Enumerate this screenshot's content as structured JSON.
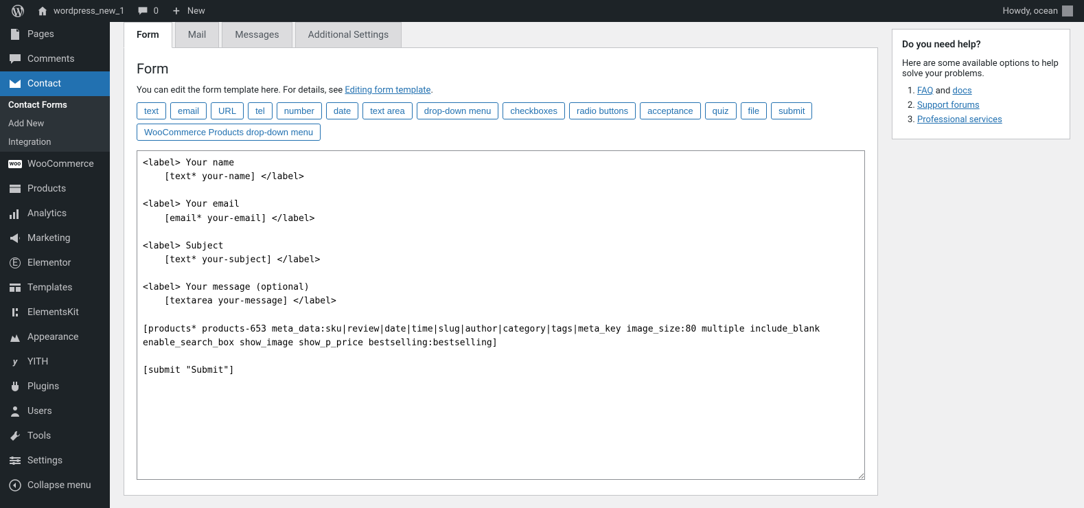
{
  "topbar": {
    "site_name": "wordpress_new_1",
    "comment_count": "0",
    "new_label": "New",
    "greeting": "Howdy, ocean"
  },
  "sidebar": {
    "items": [
      {
        "icon": "pages",
        "label": "Pages"
      },
      {
        "icon": "comments",
        "label": "Comments"
      },
      {
        "icon": "contact",
        "label": "Contact",
        "active": true
      },
      {
        "icon": "woo",
        "label": "WooCommerce"
      },
      {
        "icon": "products",
        "label": "Products"
      },
      {
        "icon": "analytics",
        "label": "Analytics"
      },
      {
        "icon": "marketing",
        "label": "Marketing"
      },
      {
        "icon": "elementor",
        "label": "Elementor"
      },
      {
        "icon": "templates",
        "label": "Templates"
      },
      {
        "icon": "elementskit",
        "label": "ElementsKit"
      },
      {
        "icon": "appearance",
        "label": "Appearance"
      },
      {
        "icon": "yith",
        "label": "YITH"
      },
      {
        "icon": "plugins",
        "label": "Plugins"
      },
      {
        "icon": "users",
        "label": "Users"
      },
      {
        "icon": "tools",
        "label": "Tools"
      },
      {
        "icon": "settings",
        "label": "Settings"
      },
      {
        "icon": "collapse",
        "label": "Collapse menu"
      }
    ],
    "contact_sub": [
      {
        "label": "Contact Forms",
        "active": true
      },
      {
        "label": "Add New"
      },
      {
        "label": "Integration"
      }
    ]
  },
  "tabs": [
    {
      "label": "Form",
      "active": true
    },
    {
      "label": "Mail"
    },
    {
      "label": "Messages"
    },
    {
      "label": "Additional Settings"
    }
  ],
  "panel": {
    "heading": "Form",
    "desc_prefix": "You can edit the form template here. For details, see ",
    "desc_link": "Editing form template",
    "desc_suffix": ".",
    "tag_buttons": [
      "text",
      "email",
      "URL",
      "tel",
      "number",
      "date",
      "text area",
      "drop-down menu",
      "checkboxes",
      "radio buttons",
      "acceptance",
      "quiz",
      "file",
      "submit"
    ],
    "tag_buttons2": [
      "WooCommerce Products drop-down menu"
    ],
    "textarea": "<label> Your name\n    [text* your-name] </label>\n\n<label> Your email\n    [email* your-email] </label>\n\n<label> Subject\n    [text* your-subject] </label>\n\n<label> Your message (optional)\n    [textarea your-message] </label>\n\n[products* products-653 meta_data:sku|review|date|time|slug|author|category|tags|meta_key image_size:80 multiple include_blank enable_search_box show_image show_p_price bestselling:bestselling]\n\n[submit \"Submit\"]"
  },
  "help": {
    "title": "Do you need help?",
    "intro": "Here are some available options to help solve your problems.",
    "items": [
      {
        "link": "FAQ",
        "mid": " and ",
        "link2": "docs"
      },
      {
        "link": "Support forums"
      },
      {
        "link": "Professional services"
      }
    ]
  }
}
